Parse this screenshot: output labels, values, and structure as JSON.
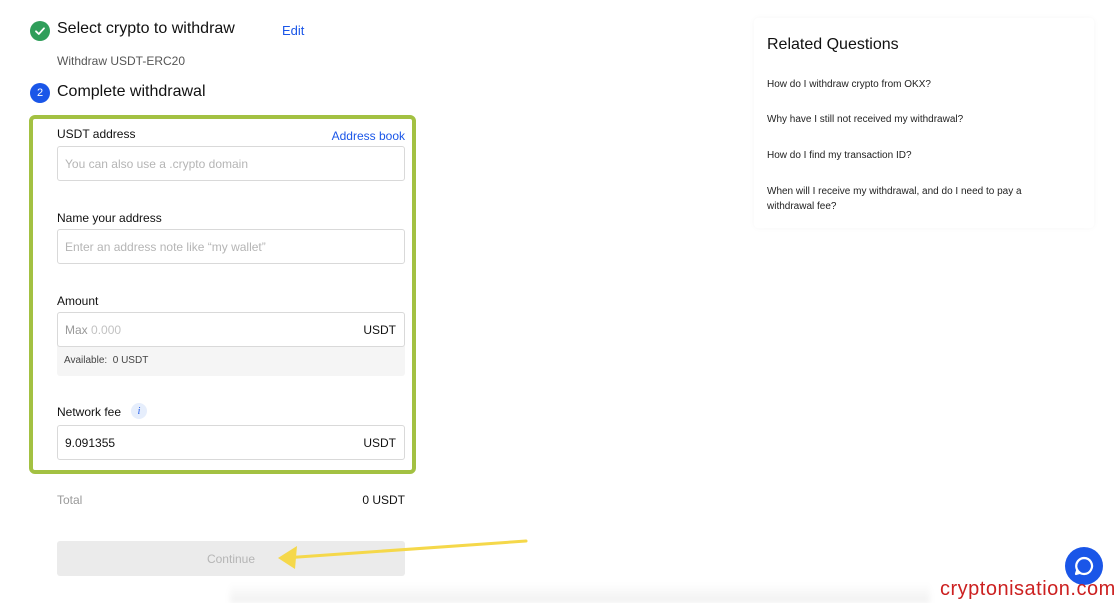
{
  "steps": {
    "step1": {
      "title": "Select crypto to withdraw",
      "edit_label": "Edit",
      "subtitle": "Withdraw USDT-ERC20",
      "icon": "check-icon"
    },
    "step2": {
      "number": "2",
      "title": "Complete withdrawal"
    }
  },
  "form": {
    "address": {
      "label": "USDT address",
      "address_book_label": "Address book",
      "placeholder": "You can also use a .crypto domain",
      "value": ""
    },
    "name": {
      "label": "Name your address",
      "placeholder": "Enter an address note like “my wallet”",
      "value": ""
    },
    "amount": {
      "label": "Amount",
      "max_prefix": "Max",
      "placeholder": "0.000",
      "unit": "USDT",
      "available_label": "Available:",
      "available_value": "0 USDT"
    },
    "network_fee": {
      "label": "Network fee",
      "info_icon": "i",
      "value": "9.091355",
      "unit": "USDT"
    },
    "highlight_color": "#a3c142"
  },
  "summary": {
    "total_label": "Total",
    "total_value": "0 USDT"
  },
  "continue_label": "Continue",
  "related": {
    "title": "Related Questions",
    "questions": [
      "How do I withdraw crypto from OKX?",
      "Why have I still not received my withdrawal?",
      "How do I find my transaction ID?",
      "When will I receive my withdrawal, and do I need to pay a withdrawal fee?"
    ]
  },
  "watermark": "cryptonisation.com",
  "colors": {
    "accent": "#1a56e8",
    "success": "#2f9e5a",
    "arrow": "#f5d84a",
    "watermark": "#cc2020"
  }
}
